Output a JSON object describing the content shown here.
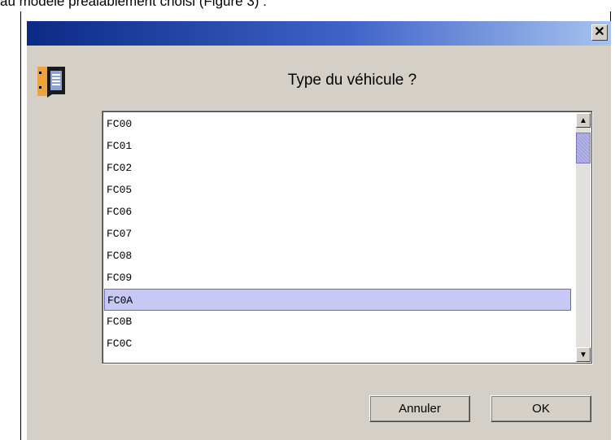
{
  "caption": {
    "text": "au modèle préalablement choisi (Figure 3) :"
  },
  "dialog": {
    "close_symbol": "✕",
    "prompt": "Type du véhicule ?",
    "list": {
      "items": [
        "FC00",
        "FC01",
        "FC02",
        "FC05",
        "FC06",
        "FC07",
        "FC08",
        "FC09",
        "FC0A",
        "FC0B",
        "FC0C"
      ],
      "selected_index": 8
    },
    "buttons": {
      "cancel": "Annuler",
      "ok": "OK"
    }
  },
  "icons": {
    "close": "close-icon",
    "app": "message-icon",
    "scroll_up": "arrow-up-icon",
    "scroll_down": "arrow-down-icon"
  },
  "colors": {
    "title_start": "#0b2a85",
    "title_end": "#a7c3ee",
    "selection": "#c8c8f5",
    "window_bg": "#d4d0c8"
  }
}
